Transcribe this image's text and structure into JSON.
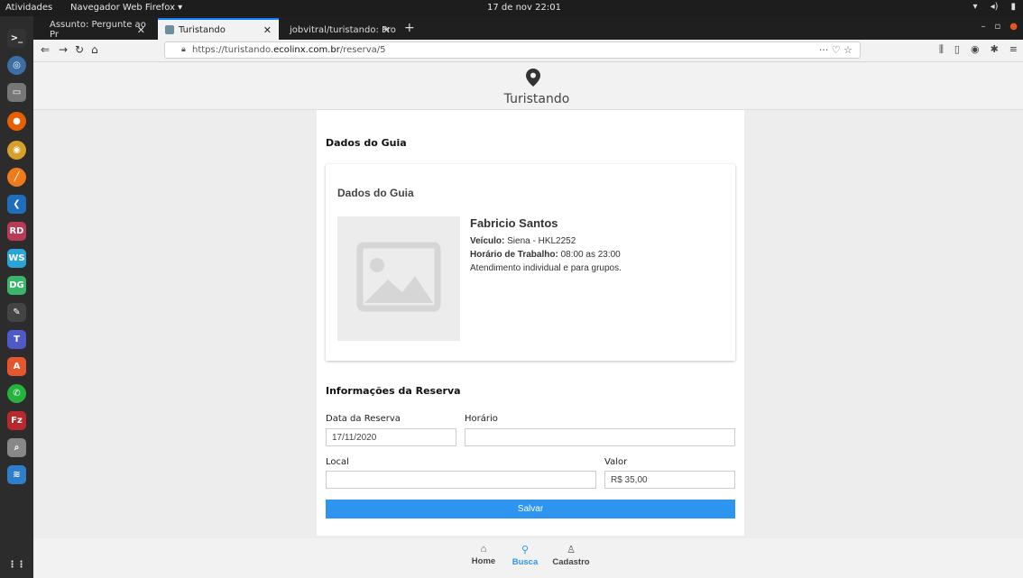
{
  "os": {
    "activities": "Atividades",
    "app_name": "Navegador Web Firefox ▾",
    "clock": "17 de nov 22:01"
  },
  "browser": {
    "tabs": [
      {
        "label": "Assunto: Pergunte ao Pr"
      },
      {
        "label": "Turistando"
      },
      {
        "label": "jobvitral/turistando: Pro"
      }
    ],
    "url_prefix": "https://turistando.",
    "url_domain": "ecolinx.com.br",
    "url_path": "/reserva/5"
  },
  "app": {
    "brand": "Turistando",
    "section_title": "Dados do Guia",
    "guide_card_title": "Dados do Guia",
    "guide": {
      "name": "Fabricio Santos",
      "vehicle_label": "Veículo:",
      "vehicle_value": " Siena - HKL2252",
      "hours_label": "Horário de Trabalho:",
      "hours_value": " 08:00 as 23:00",
      "description": "Atendimento individual e para grupos."
    },
    "reservation_title": "Informações da Reserva",
    "fields": {
      "date_label": "Data da Reserva",
      "date_value": "17/11/2020",
      "time_label": "Horário",
      "time_value": "",
      "place_label": "Local",
      "place_value": "",
      "price_label": "Valor",
      "price_value": "R$ 35,00"
    },
    "save_button": "Salvar",
    "bottom_nav": [
      {
        "label": "Home",
        "icon": "home-icon"
      },
      {
        "label": "Busca",
        "icon": "search-icon"
      },
      {
        "label": "Cadastro",
        "icon": "user-icon"
      }
    ]
  },
  "colors": {
    "accent": "#2d95f0",
    "browser_tab_accent": "#0a84ff"
  }
}
